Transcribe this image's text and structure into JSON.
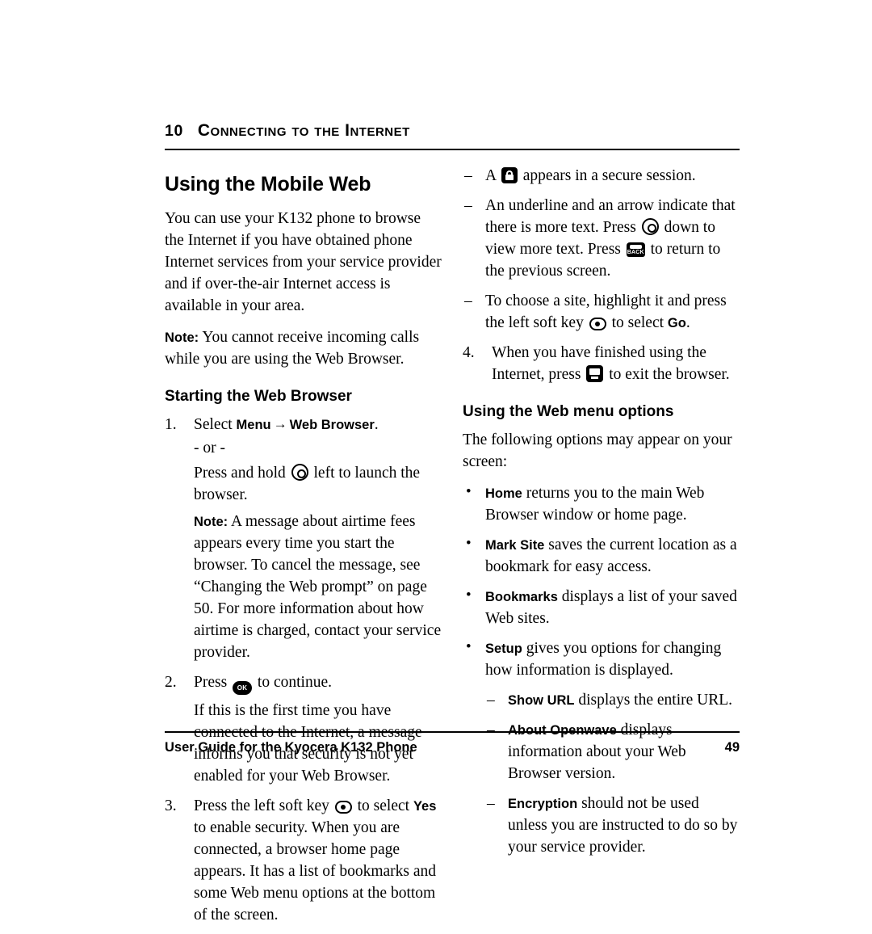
{
  "chapter": {
    "number": "10",
    "title": "Connecting to the Internet"
  },
  "left_column": {
    "section_title": "Using the Mobile Web",
    "intro": "You can use your K132 phone to browse the Internet if you have obtained phone Internet services from your service provider and if over-the-air Internet access is available in your area.",
    "note_label": "Note:",
    "note_text": " You cannot receive incoming calls while you are using the Web Browser.",
    "subsection_title": "Starting the Web Browser",
    "step1": {
      "number": "1.",
      "text_a": "Select ",
      "menu": "Menu",
      "arrow": "→",
      "web_browser": "Web Browser",
      "period": ".",
      "or": "- or -",
      "press_hold_a": "Press and hold ",
      "press_hold_b": " left to launch the browser.",
      "note_label": "Note:",
      "note_text": " A message about airtime fees appears every time you start the browser. To cancel the message, see “Changing the Web prompt” on page 50. For more information about how airtime is charged, contact your service provider."
    },
    "step2": {
      "number": "2.",
      "text_a": "Press ",
      "text_b": " to continue.",
      "detail": "If this is the first time you have connected to the Internet, a message informs you that security is not yet enabled for your Web Browser."
    },
    "step3": {
      "number": "3.",
      "text_a": "Press the left soft key ",
      "text_b": " to select ",
      "yes": "Yes",
      "text_c": " to enable security. When you are connected, a browser home page appears. It has a list of bookmarks and some Web menu options at the bottom of the screen."
    }
  },
  "right_column": {
    "dash1": {
      "text_a": "A ",
      "text_b": " appears in a secure session."
    },
    "dash2": {
      "text_a": "An underline and an arrow indicate that there is more text. Press ",
      "text_b": " down to view more text. Press ",
      "text_c": " to return to the previous screen."
    },
    "dash3": {
      "text_a": "To choose a site, highlight it and press the left soft key ",
      "text_b": " to select ",
      "go": "Go",
      "text_c": "."
    },
    "step4": {
      "number": "4.",
      "text_a": "When you have finished using the Internet, press ",
      "text_b": " to exit the browser."
    },
    "subsection_title": "Using the Web menu options",
    "intro": "The following options may appear on your screen:",
    "bullets": [
      {
        "term": "Home",
        "desc": " returns you to the main Web Browser window or home page."
      },
      {
        "term": "Mark Site",
        "desc": " saves the current location as a bookmark for easy access."
      },
      {
        "term": "Bookmarks",
        "desc": " displays a list of your saved Web sites."
      },
      {
        "term": "Setup",
        "desc": " gives you options for changing how information is displayed."
      }
    ],
    "sub_dashes": [
      {
        "term": "Show URL",
        "desc": " displays the entire URL."
      },
      {
        "term": "About Openwave",
        "desc": " displays information about your Web Browser version."
      },
      {
        "term": "Encryption",
        "desc": " should not be used unless you are instructed to do so by your service provider."
      }
    ]
  },
  "footer": {
    "left": "User Guide for the Kyocera K132 Phone",
    "page_number": "49"
  }
}
